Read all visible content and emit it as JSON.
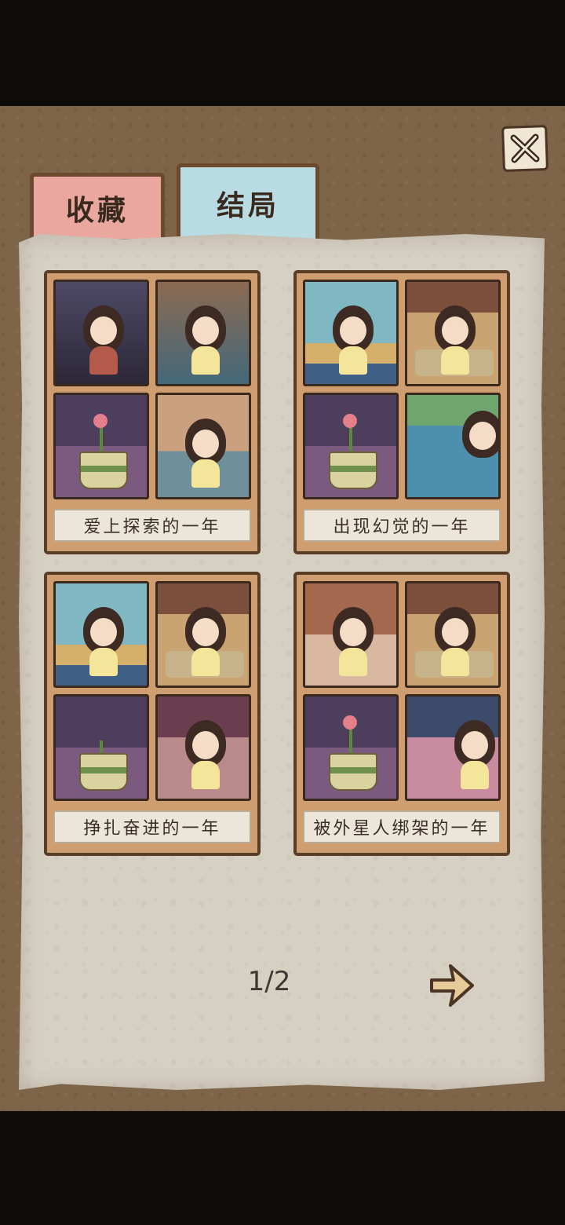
{
  "tabs": [
    {
      "label": "收藏",
      "active": false
    },
    {
      "label": "结局",
      "active": true
    }
  ],
  "close": {
    "icon": "close-icon"
  },
  "endings": [
    {
      "title": "爱上探索的一年",
      "scenes": [
        "girl-reading",
        "girl-gaming",
        "life-plant",
        "girl-with-plants"
      ]
    },
    {
      "title": "出现幻觉的一年",
      "scenes": [
        "girl-yoga-window",
        "girl-meditating-bed",
        "life-plant",
        "girl-fishing"
      ]
    },
    {
      "title": "挣扎奋进的一年",
      "scenes": [
        "girl-yoga-window",
        "girl-meditating-bed",
        "life-plant-sprout",
        "girl-in-library"
      ]
    },
    {
      "title": "被外星人绑架的一年",
      "scenes": [
        "girl-studying-desk",
        "girl-meditating-bed",
        "life-plant",
        "girl-dining"
      ]
    }
  ],
  "pagination": {
    "text": "1/2",
    "next_icon": "arrow-right-icon"
  },
  "colors": {
    "board": "#7e6448",
    "paper": "#d6d0c3",
    "card": "#cf9e70",
    "tab_fav": "#e9a7a0",
    "tab_end": "#b9dbe4"
  }
}
